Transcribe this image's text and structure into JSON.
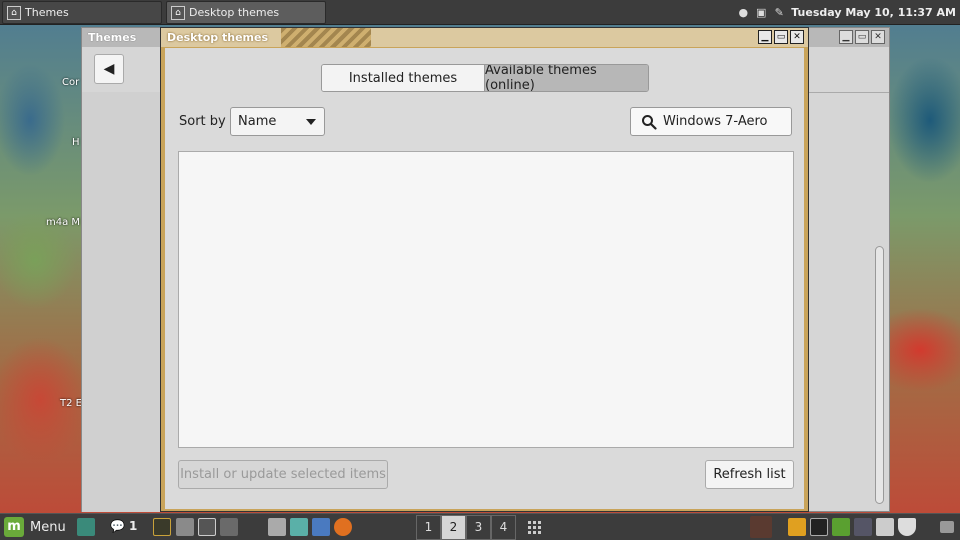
{
  "top_panel": {
    "tasks": [
      {
        "label": "Themes"
      },
      {
        "label": "Desktop themes"
      }
    ],
    "clock": "Tuesday May 10, 11:37 AM"
  },
  "desktop": {
    "labels": [
      "Cor",
      "H",
      "m4a M",
      "T2 E"
    ]
  },
  "themes_window": {
    "title": "Themes",
    "back_icon": "arrow-left-icon"
  },
  "dialog": {
    "title": "Desktop themes",
    "tabs": {
      "installed": "Installed themes",
      "available": "Available themes (online)",
      "active": "available"
    },
    "sort": {
      "label": "Sort by",
      "value": "Name"
    },
    "search": {
      "value": "Windows 7-Aero"
    },
    "buttons": {
      "install": "Install or update selected items",
      "refresh": "Refresh list"
    }
  },
  "bottom_panel": {
    "menu_label": "Menu",
    "notifications": "1",
    "workspaces": [
      "1",
      "2",
      "3",
      "4"
    ],
    "active_workspace": "2"
  }
}
